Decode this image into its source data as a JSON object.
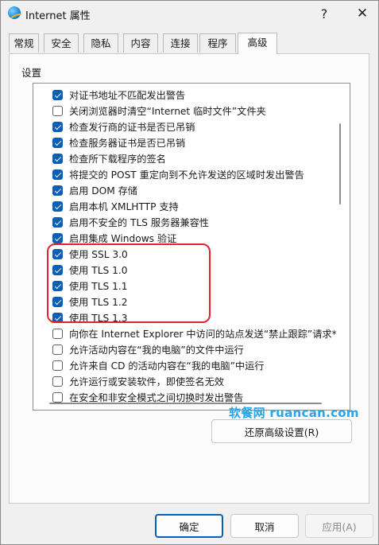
{
  "window": {
    "title": "Internet 属性",
    "help_label": "?",
    "close_label": "✕"
  },
  "tabs": [
    {
      "label": "常规"
    },
    {
      "label": "安全"
    },
    {
      "label": "隐私"
    },
    {
      "label": "内容"
    },
    {
      "label": "连接"
    },
    {
      "label": "程序"
    },
    {
      "label": "高级",
      "active": true
    }
  ],
  "settings": {
    "group_label": "设置",
    "items": [
      {
        "label": "对证书地址不匹配发出警告",
        "checked": true
      },
      {
        "label": "关闭浏览器时清空“Internet 临时文件”文件夹",
        "checked": false
      },
      {
        "label": "检查发行商的证书是否已吊销",
        "checked": true
      },
      {
        "label": "检查服务器证书是否已吊销",
        "checked": true
      },
      {
        "label": "检查所下载程序的签名",
        "checked": true
      },
      {
        "label": "将提交的 POST 重定向到不允许发送的区域时发出警告",
        "checked": true
      },
      {
        "label": "启用 DOM 存储",
        "checked": true
      },
      {
        "label": "启用本机 XMLHTTP 支持",
        "checked": true
      },
      {
        "label": "启用不安全的 TLS 服务器兼容性",
        "checked": true
      },
      {
        "label": "启用集成 Windows 验证",
        "checked": true
      },
      {
        "label": "使用 SSL 3.0",
        "checked": true
      },
      {
        "label": "使用 TLS 1.0",
        "checked": true
      },
      {
        "label": "使用 TLS 1.1",
        "checked": true
      },
      {
        "label": "使用 TLS 1.2",
        "checked": true
      },
      {
        "label": "使用 TLS 1.3",
        "checked": true
      },
      {
        "label": "向你在 Internet Explorer 中访问的站点发送“禁止跟踪”请求*",
        "checked": false
      },
      {
        "label": "允许活动内容在“我的电脑”的文件中运行",
        "checked": false
      },
      {
        "label": "允许来自 CD 的活动内容在“我的电脑”中运行",
        "checked": false
      },
      {
        "label": "允许运行或安装软件，即使签名无效",
        "checked": false
      },
      {
        "label": "在安全和非安全模式之间切换时发出警告",
        "checked": false
      }
    ]
  },
  "watermark": "软餐网 ruancan.com",
  "buttons": {
    "restore_advanced": "还原高级设置(R)",
    "ok": "确定",
    "cancel": "取消",
    "apply": "应用(A)"
  },
  "colors": {
    "accent": "#0a5fb4",
    "highlight_border": "#e3242b",
    "watermark": "#2aa5e8"
  }
}
